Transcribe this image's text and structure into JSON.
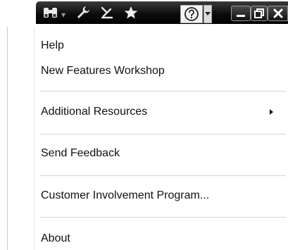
{
  "toolbar": {
    "icons": [
      "binoculars-icon",
      "wrench-icon",
      "pin-icon",
      "star-icon",
      "help-icon",
      "dropdown-arrow-icon"
    ],
    "window_controls": [
      "minimize-icon",
      "restore-icon",
      "close-icon"
    ]
  },
  "menu": {
    "items": [
      {
        "label": "Help"
      },
      {
        "label": "New Features Workshop"
      },
      {
        "label": "Additional Resources",
        "has_submenu": true
      },
      {
        "label": "Send Feedback"
      },
      {
        "label": "Customer Involvement Program..."
      },
      {
        "label": "About"
      }
    ]
  },
  "colors": {
    "toolbar_bg": "#0d0d0d",
    "menu_bg": "#ffffff",
    "divider": "#d4d4d4"
  }
}
